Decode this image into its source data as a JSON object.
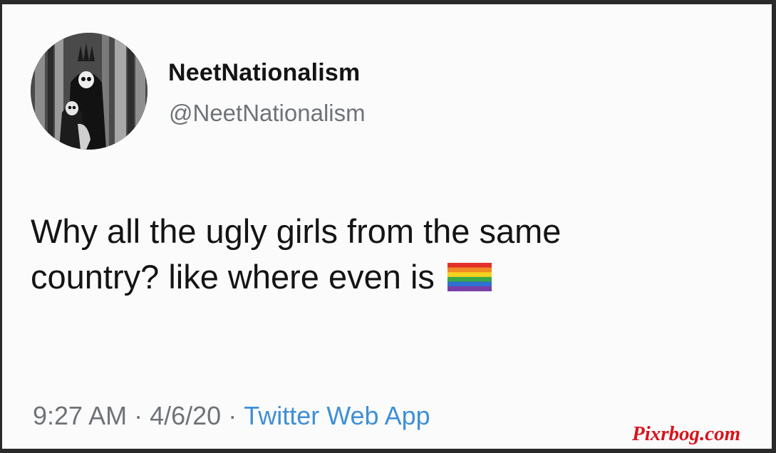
{
  "tweet": {
    "author": {
      "display_name": "NeetNationalism",
      "handle": "@NeetNationalism",
      "avatar_icon": "avatar-dark-forest-skull-figures"
    },
    "text_line_1": "Why all the ugly girls from the same",
    "text_line_2": "country? like where even is",
    "emoji": "rainbow-flag-icon",
    "time": "9:27 AM",
    "separator": "·",
    "date": "4/6/20",
    "source": "Twitter Web App"
  },
  "watermark": "Pixrbog.com",
  "colors": {
    "link": "#3f8fd6",
    "secondary_text": "#6f7378",
    "watermark": "#d8141c"
  }
}
